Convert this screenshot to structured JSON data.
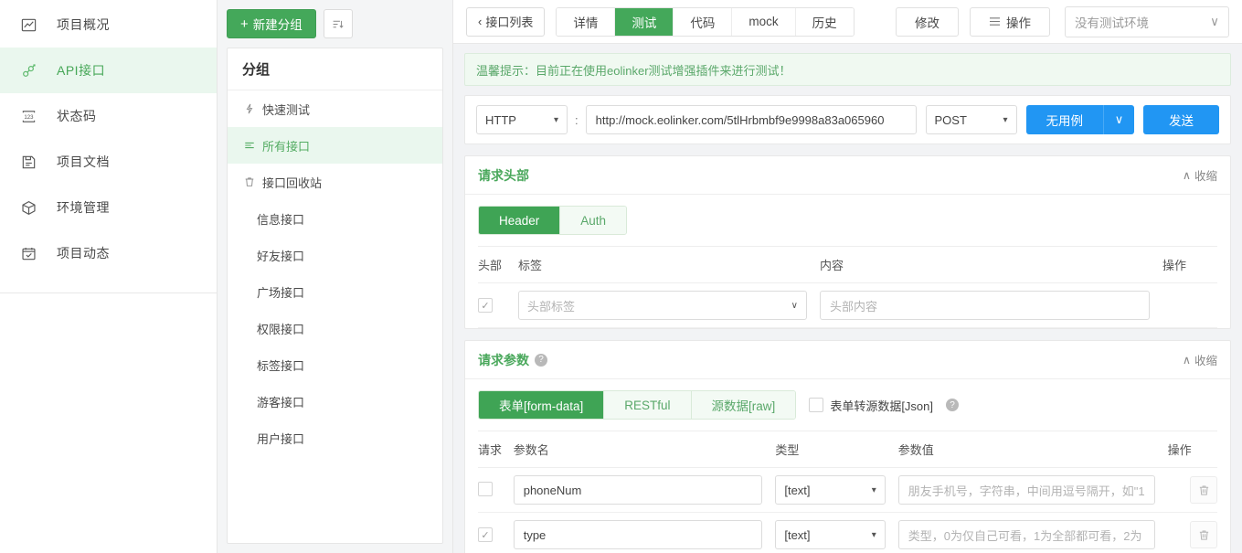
{
  "left_nav": {
    "items": [
      {
        "label": "项目概况",
        "icon": "chart-icon",
        "active": false
      },
      {
        "label": "API接口",
        "icon": "api-link-icon",
        "active": true
      },
      {
        "label": "状态码",
        "icon": "status-code-icon",
        "active": false
      },
      {
        "label": "项目文档",
        "icon": "document-icon",
        "active": false
      },
      {
        "label": "环境管理",
        "icon": "cube-icon",
        "active": false
      },
      {
        "label": "项目动态",
        "icon": "calendar-check-icon",
        "active": false
      }
    ]
  },
  "group_panel": {
    "new_group_button": "新建分组",
    "new_group_plus": "+",
    "sort_button_icon": "sort-icon",
    "title": "分组",
    "rows": [
      {
        "label": "快速测试",
        "icon": "lightning-icon",
        "active": false
      },
      {
        "label": "所有接口",
        "icon": "list-icon",
        "active": true
      },
      {
        "label": "接口回收站",
        "icon": "trash-icon",
        "active": false
      }
    ],
    "sub_rows": [
      {
        "label": "信息接口"
      },
      {
        "label": "好友接口"
      },
      {
        "label": "广场接口"
      },
      {
        "label": "权限接口"
      },
      {
        "label": "标签接口"
      },
      {
        "label": "游客接口"
      },
      {
        "label": "用户接口"
      }
    ]
  },
  "topbar": {
    "back_label": "接口列表",
    "back_caret": "‹",
    "tabs": [
      {
        "label": "详情",
        "active": false
      },
      {
        "label": "测试",
        "active": true
      },
      {
        "label": "代码",
        "active": false
      },
      {
        "label": "mock",
        "active": false
      },
      {
        "label": "历史",
        "active": false
      }
    ],
    "modify_label": "修改",
    "action_label": "操作",
    "action_icon": "hamburger-icon",
    "env_value": "没有测试环境",
    "env_caret": "∨"
  },
  "tip": {
    "text": "温馨提示：目前正在使用eolinker测试增强插件来进行测试！"
  },
  "url_row": {
    "protocol": "HTTP",
    "protocol_caret": "▾",
    "separator": ":",
    "url": "http://mock.eolinker.com/5tlHrbmbf9e9998a83a065960",
    "method": "POST",
    "method_caret": "▾",
    "case_label": "无用例",
    "case_caret": "∨",
    "send_label": "发送"
  },
  "request_header": {
    "title": "请求头部",
    "collapse_label": "收缩",
    "collapse_caret": "∧",
    "tabs": [
      {
        "label": "Header",
        "active": true
      },
      {
        "label": "Auth",
        "active": false
      }
    ],
    "columns": {
      "enabled": "头部",
      "label": "标签",
      "content": "内容",
      "operation": "操作"
    },
    "rows": [
      {
        "checked": true,
        "label_placeholder": "头部标签",
        "label_caret": "∨",
        "content_placeholder": "头部内容"
      }
    ]
  },
  "request_params": {
    "title": "请求参数",
    "title_help": "?",
    "collapse_label": "收缩",
    "collapse_caret": "∧",
    "tabs": [
      {
        "label": "表单[form-data]",
        "active": true
      },
      {
        "label": "RESTful",
        "active": false
      },
      {
        "label": "源数据[raw]",
        "active": false
      }
    ],
    "convert_checkbox": {
      "label": "表单转源数据[Json]",
      "checked": false,
      "help": "?"
    },
    "columns": {
      "enabled": "请求",
      "name": "参数名",
      "type": "类型",
      "value": "参数值",
      "operation": "操作"
    },
    "rows": [
      {
        "checked": false,
        "name": "phoneNum",
        "type": "[text]",
        "type_caret": "▾",
        "value_placeholder": "朋友手机号，字符串，中间用逗号隔开，如\"1",
        "delete_icon": "trash-icon"
      },
      {
        "checked": true,
        "name": "type",
        "type": "[text]",
        "type_caret": "▾",
        "value_placeholder": "类型，0为仅自己可看，1为全部都可看，2为",
        "delete_icon": "trash-icon"
      }
    ]
  },
  "colors": {
    "brand_green": "#44a85a",
    "light_green_bg": "#eaf7ee",
    "blue": "#2196f3",
    "tip_bg": "#f0f9f1"
  }
}
